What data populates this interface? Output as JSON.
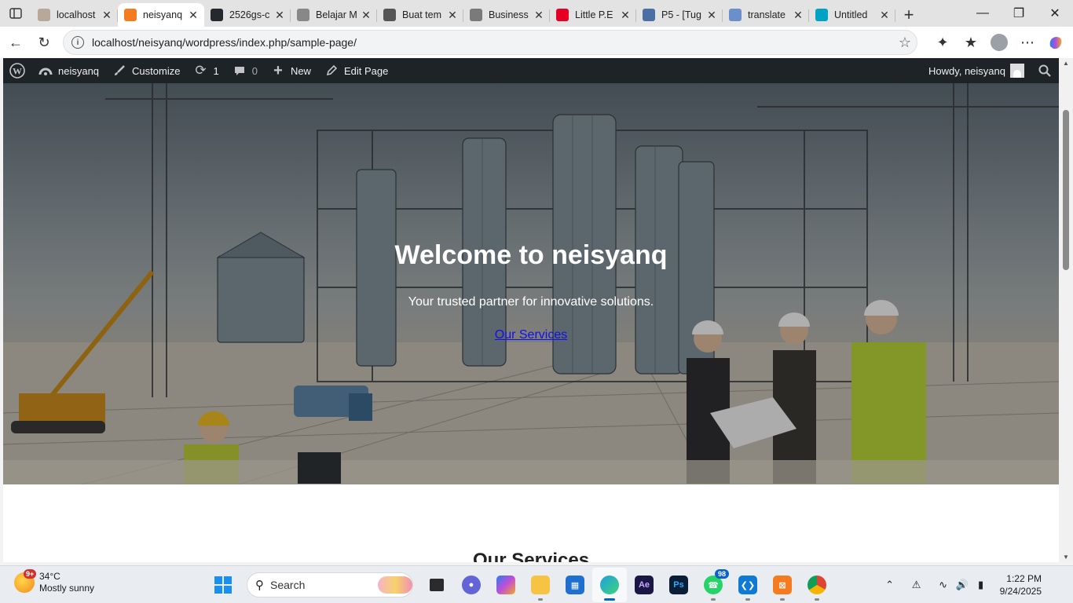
{
  "browser": {
    "tabs": [
      {
        "title": "localhost",
        "icon": "xampp-icon",
        "color": "#b8a89a"
      },
      {
        "title": "neisyanq",
        "icon": "xampp-icon",
        "color": "#f47b20",
        "active": true
      },
      {
        "title": "2526gs-c",
        "icon": "github-icon",
        "color": "#24292f"
      },
      {
        "title": "Belajar M",
        "icon": "face-icon",
        "color": "#888888"
      },
      {
        "title": "Buat tem",
        "icon": "openai-icon",
        "color": "#555555"
      },
      {
        "title": "Business",
        "icon": "w-icon",
        "color": "#7a7a7a"
      },
      {
        "title": "Little P.E",
        "icon": "pinterest-icon",
        "color": "#e60023"
      },
      {
        "title": "P5 - [Tug",
        "icon": "classroom-icon",
        "color": "#4a6fa5"
      },
      {
        "title": "translate",
        "icon": "search-icon",
        "color": "#6b8fc8"
      },
      {
        "title": "Untitled",
        "icon": "canva-icon",
        "color": "#00a3c4"
      }
    ],
    "url": "localhost/neisyanq/wordpress/index.php/sample-page/"
  },
  "adminbar": {
    "site_name": "neisyanq",
    "customize": "Customize",
    "updates_count": "1",
    "comments_count": "0",
    "new_label": "New",
    "edit_page": "Edit Page",
    "howdy": "Howdy, neisyanq"
  },
  "hero": {
    "title": "Welcome to neisyanq",
    "subtitle": "Your trusted partner for innovative solutions.",
    "link": "Our Services"
  },
  "services": {
    "heading": "Our Services"
  },
  "taskbar": {
    "weather_badge": "9+",
    "temperature": "34°C",
    "condition": "Mostly sunny",
    "search_placeholder": "Search",
    "whatsapp_badge": "98",
    "time": "1:22 PM",
    "date": "9/24/2025"
  }
}
